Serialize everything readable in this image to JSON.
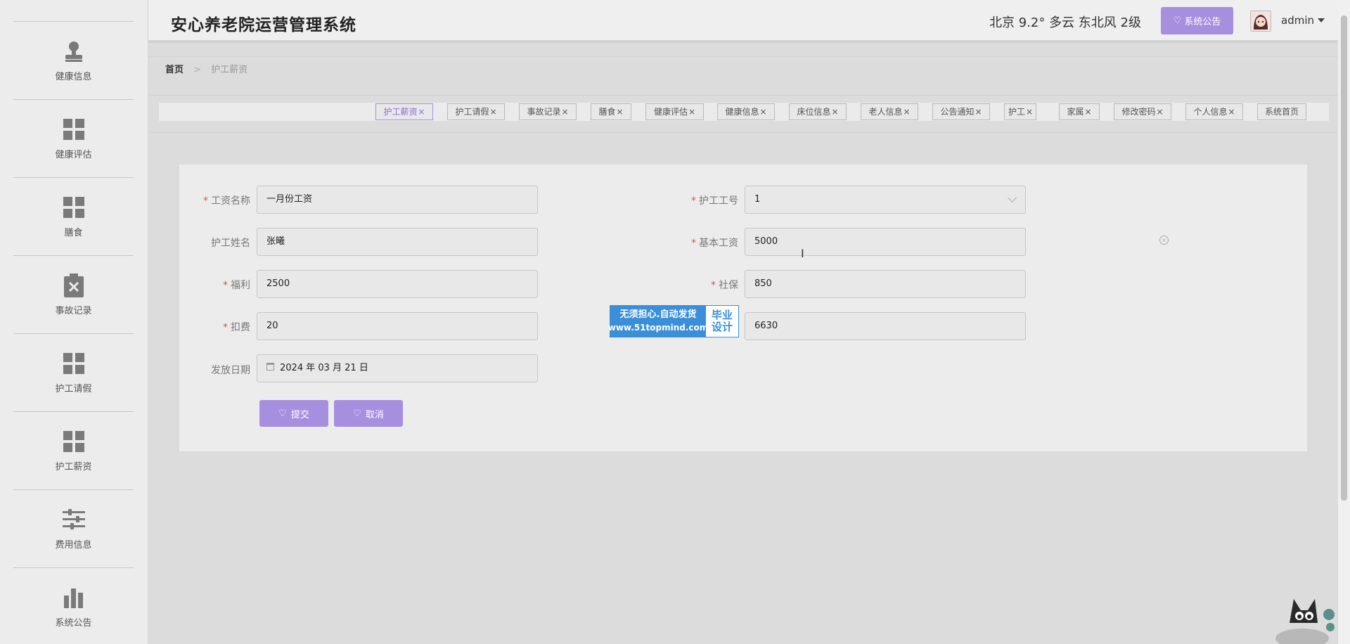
{
  "app": {
    "title": "安心养老院运营管理系统"
  },
  "header": {
    "weather": "北京  9.2°  多云  东北风  2级",
    "notice_button": "系统公告",
    "username": "admin"
  },
  "sidebar": {
    "items": [
      {
        "label": "健康信息",
        "icon": "user-icon"
      },
      {
        "label": "健康评估",
        "icon": "grid-icon"
      },
      {
        "label": "膳食",
        "icon": "grid-icon"
      },
      {
        "label": "事故记录",
        "icon": "clipboard-x-icon"
      },
      {
        "label": "护工请假",
        "icon": "grid-icon"
      },
      {
        "label": "护工薪资",
        "icon": "grid-icon"
      },
      {
        "label": "费用信息",
        "icon": "sliders-icon"
      },
      {
        "label": "系统公告",
        "icon": "bar-chart-icon"
      }
    ]
  },
  "breadcrumb": {
    "home": "首页",
    "separator": ">",
    "current": "护工薪资"
  },
  "tabs": [
    {
      "label": "护工薪资",
      "close": "×",
      "active": true
    },
    {
      "label": "护工请假",
      "close": "×"
    },
    {
      "label": "事故记录",
      "close": "×"
    },
    {
      "label": "膳食",
      "close": "×"
    },
    {
      "label": "健康评估",
      "close": "×"
    },
    {
      "label": "健康信息",
      "close": "×"
    },
    {
      "label": "床位信息",
      "close": "×"
    },
    {
      "label": "老人信息",
      "close": "×"
    },
    {
      "label": "公告通知",
      "close": "×"
    },
    {
      "label": "护工",
      "close": "×"
    },
    {
      "label": "家属",
      "close": "×"
    },
    {
      "label": "修改密码",
      "close": "×"
    },
    {
      "label": "个人信息",
      "close": "×"
    },
    {
      "label": "系统首页",
      "close": ""
    }
  ],
  "form": {
    "salary_name": {
      "label": "工资名称",
      "required": "*",
      "value": "一月份工资"
    },
    "worker_no": {
      "label": "护工工号",
      "required": "*",
      "value": "1"
    },
    "worker_name": {
      "label": "护工姓名",
      "value": "张曦"
    },
    "base_salary": {
      "label": "基本工资",
      "required": "*",
      "value": "5000"
    },
    "welfare": {
      "label": "福利",
      "required": "*",
      "value": "2500"
    },
    "social_security": {
      "label": "社保",
      "required": "*",
      "value": "850"
    },
    "deduction": {
      "label": "扣费",
      "required": "*",
      "value": "20"
    },
    "actual_salary": {
      "value": "6630"
    },
    "pay_date": {
      "label": "发放日期",
      "value": "2024 年 03 月 21 日"
    },
    "submit_button": "提交",
    "cancel_button": "取消"
  },
  "watermark": {
    "line1": "无须担心.自动发货",
    "line2": "www.51topmind.com",
    "badge_line1": "毕业",
    "badge_line2": "设计"
  },
  "colors": {
    "accent": "#a78fe0",
    "required": "#e05050",
    "watermark_blue": "#3a8fd8"
  }
}
